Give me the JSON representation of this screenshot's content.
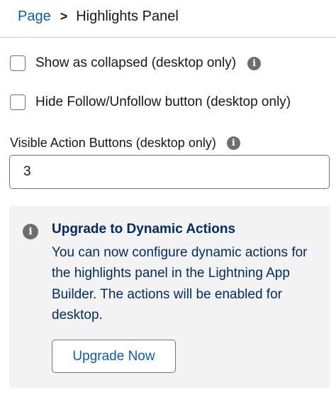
{
  "breadcrumb": {
    "parent": "Page",
    "separator": ">",
    "current": "Highlights Panel"
  },
  "options": [
    {
      "label": "Show as collapsed (desktop only)",
      "checked": false,
      "has_info_icon": true
    },
    {
      "label": "Hide Follow/Unfollow button (desktop only)",
      "checked": false,
      "has_info_icon": false
    }
  ],
  "visible_action_buttons": {
    "label": "Visible Action Buttons (desktop only)",
    "value": "3"
  },
  "notice": {
    "icon": "info-icon",
    "title": "Upgrade to Dynamic Actions",
    "body": "You can now configure dynamic actions for the highlights panel in the Lightning App Builder. The actions will be enabled for desktop.",
    "button_label": "Upgrade Now"
  },
  "colors": {
    "link": "#0b5cab",
    "notice_text": "#032d60",
    "notice_bg": "#f3f3f3",
    "icon_gray": "#706e6b"
  }
}
